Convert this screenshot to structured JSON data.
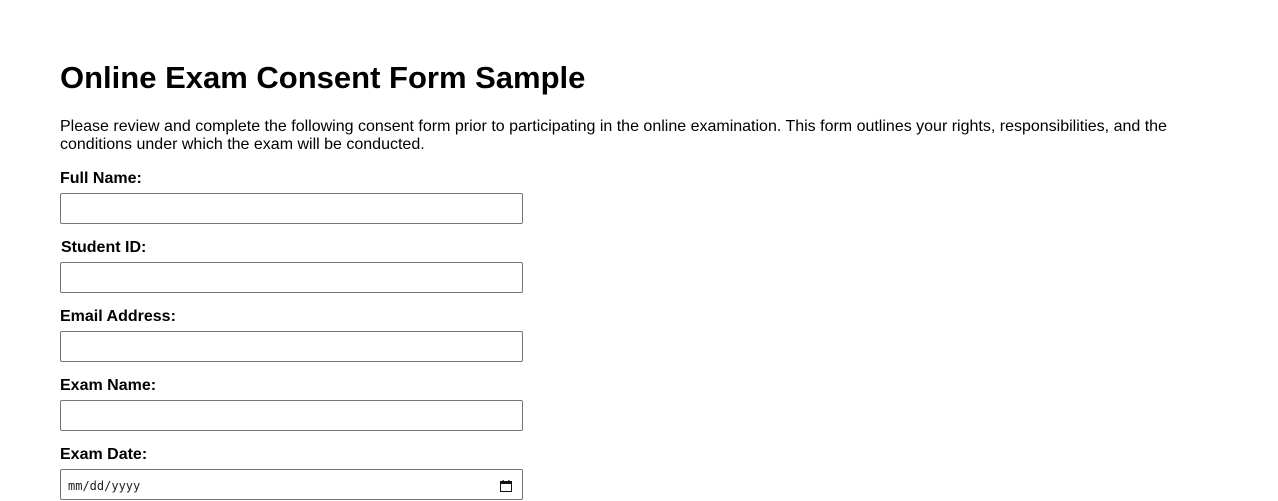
{
  "page": {
    "title": "Online Exam Consent Form Sample",
    "intro": "Please review and complete the following consent form prior to participating in the online examination. This form outlines your rights, responsibilities, and the conditions under which the exam will be conducted."
  },
  "form": {
    "full_name": {
      "label": "Full Name:",
      "value": ""
    },
    "student_id": {
      "label": "Student ID:",
      "value": ""
    },
    "email": {
      "label": "Email Address:",
      "value": ""
    },
    "exam_name": {
      "label": "Exam Name:",
      "value": ""
    },
    "exam_date": {
      "label": "Exam Date:",
      "placeholder": "mm/dd/yyyy",
      "icon": "calendar-icon"
    }
  }
}
